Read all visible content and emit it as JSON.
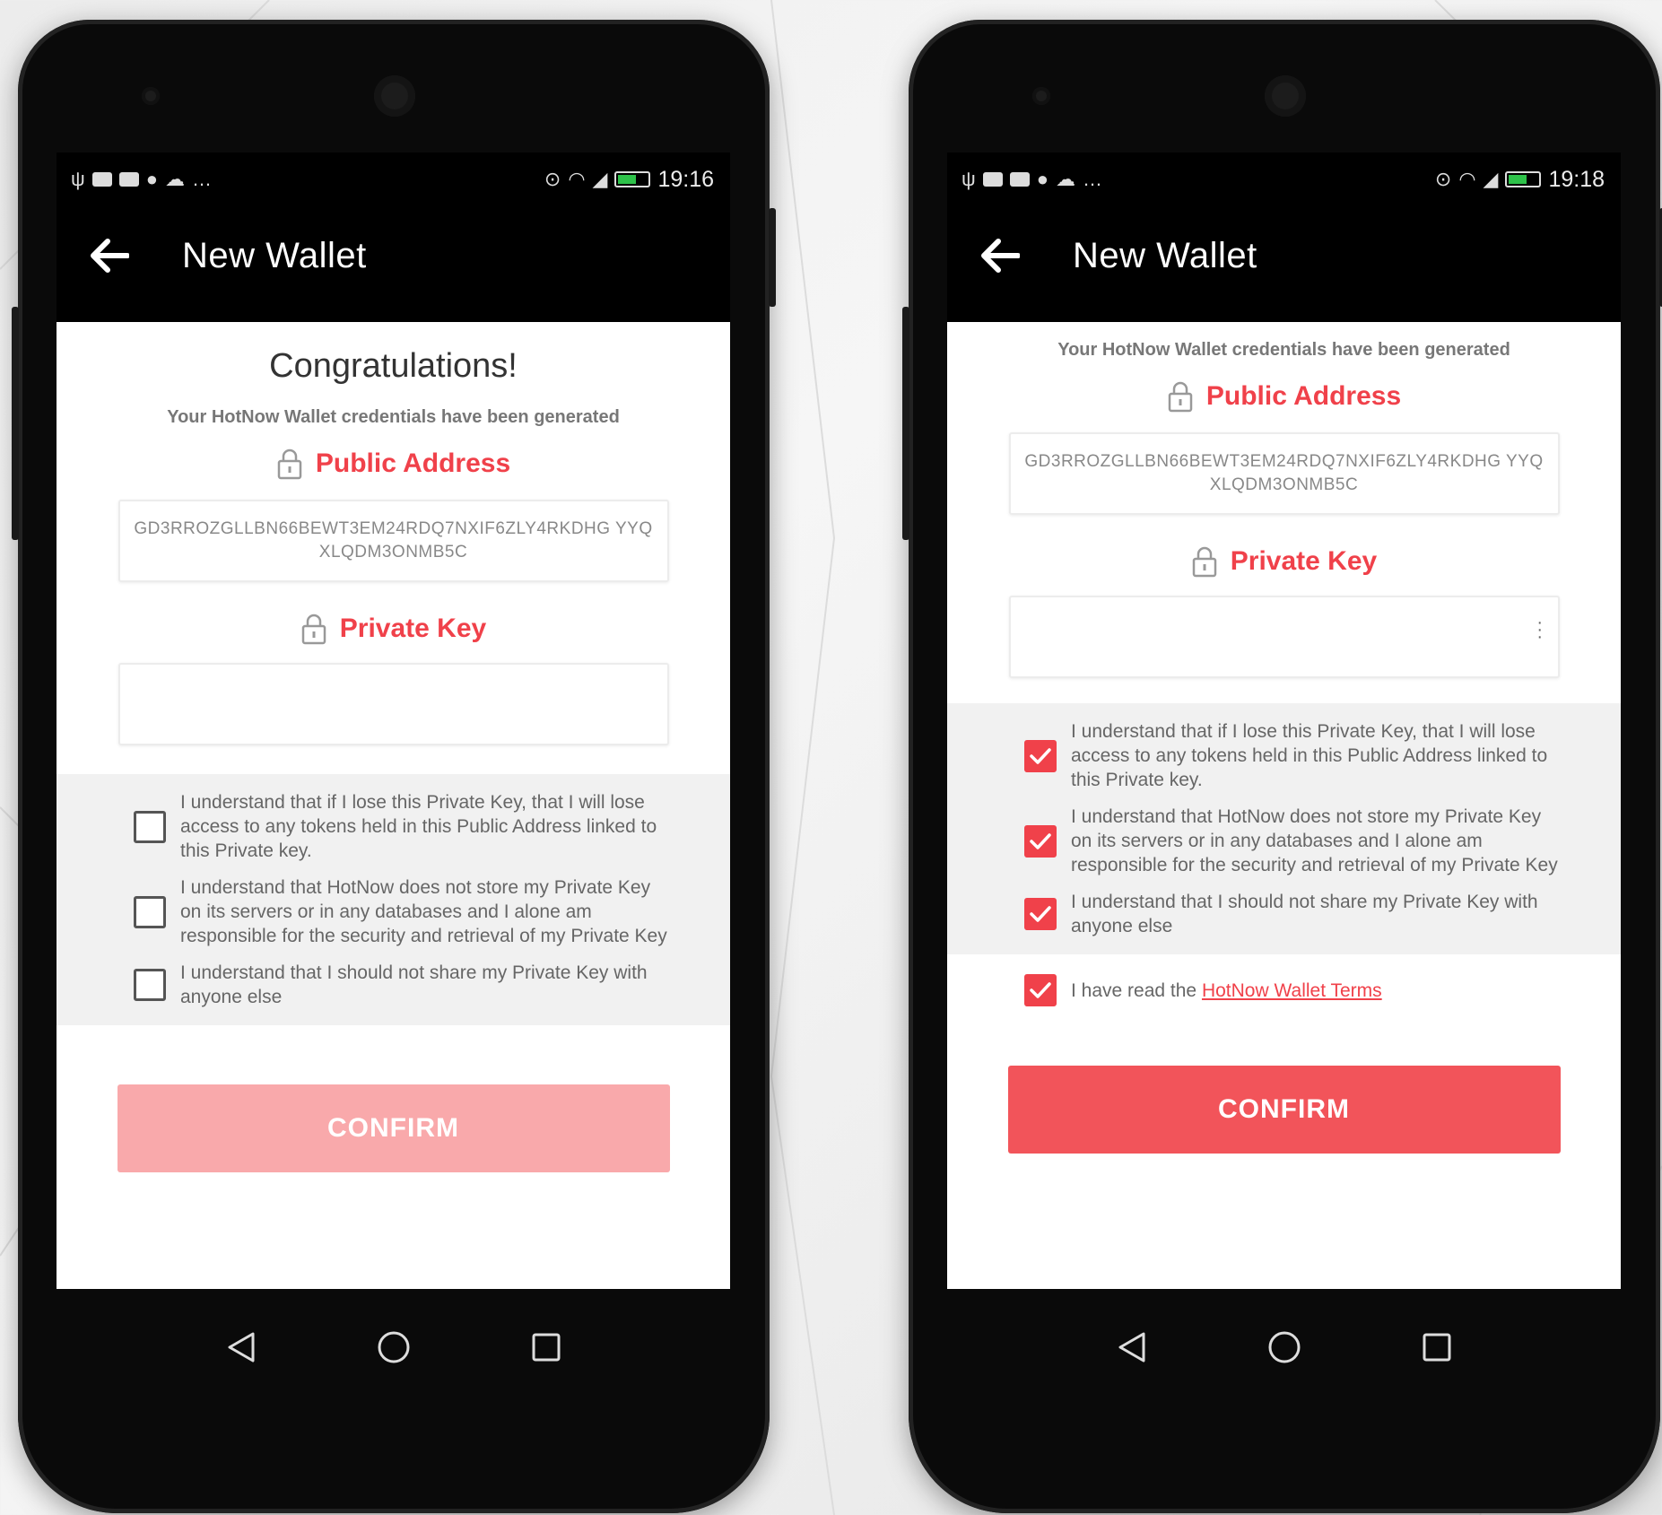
{
  "left_screen": {
    "status": {
      "time": "19:16"
    },
    "toolbar": {
      "title": "New Wallet"
    },
    "heading": "Congratulations!",
    "subtitle": "Your HotNow Wallet credentials have been generated",
    "public_address": {
      "label": "Public Address",
      "value": "GD3RROZGLLBN66BEWT3EM24RDQ7NXIF6ZLY4RKDHG YYQXLQDM3ONMB5C"
    },
    "private_key": {
      "label": "Private Key",
      "value": ""
    },
    "checks": [
      {
        "text": "I understand that if I lose this Private Key, that I will lose access to any tokens held in this Public Address linked to this Private key.",
        "checked": false
      },
      {
        "text": "I understand that HotNow does not store my Private Key on its servers or in any databases and I alone am responsible for the security and retrieval of my Private Key",
        "checked": false
      },
      {
        "text": "I understand that I should not share my Private Key with anyone else",
        "checked": false
      }
    ],
    "confirm_label": "CONFIRM",
    "confirm_enabled": false
  },
  "right_screen": {
    "status": {
      "time": "19:18"
    },
    "toolbar": {
      "title": "New Wallet"
    },
    "subtitle": "Your HotNow Wallet credentials have been generated",
    "public_address": {
      "label": "Public Address",
      "value": "GD3RROZGLLBN66BEWT3EM24RDQ7NXIF6ZLY4RKDHG YYQXLQDM3ONMB5C"
    },
    "private_key": {
      "label": "Private Key",
      "value": ""
    },
    "checks": [
      {
        "text": "I understand that if I lose this Private Key, that I will lose access to any tokens held in this Public Address linked to this Private key.",
        "checked": true
      },
      {
        "text": "I understand that HotNow does not store my Private Key on its servers or in any databases and I alone am responsible for the security and retrieval of my Private Key",
        "checked": true
      },
      {
        "text": "I understand that I should not share my Private Key with anyone else",
        "checked": true
      }
    ],
    "terms": {
      "prefix": "I have read the",
      "link": "HotNow Wallet Terms",
      "checked": true
    },
    "confirm_label": "CONFIRM",
    "confirm_enabled": true
  },
  "colors": {
    "accent": "#f0414a",
    "confirm_disabled": "#f9a9ab",
    "confirm_enabled": "#f2545a",
    "toolbar": "#000000",
    "checkbox_area": "#f1f1f1"
  },
  "icons": {
    "status_left": [
      "usb-icon",
      "image-icon",
      "youtube-icon",
      "chat-icon",
      "cloud-icon",
      "more-icon"
    ],
    "status_right": [
      "location-icon",
      "wifi-icon",
      "signal-icon",
      "battery-icon"
    ],
    "section": "lock-icon",
    "nav": [
      "back-triangle-icon",
      "home-circle-icon",
      "recents-square-icon"
    ]
  }
}
